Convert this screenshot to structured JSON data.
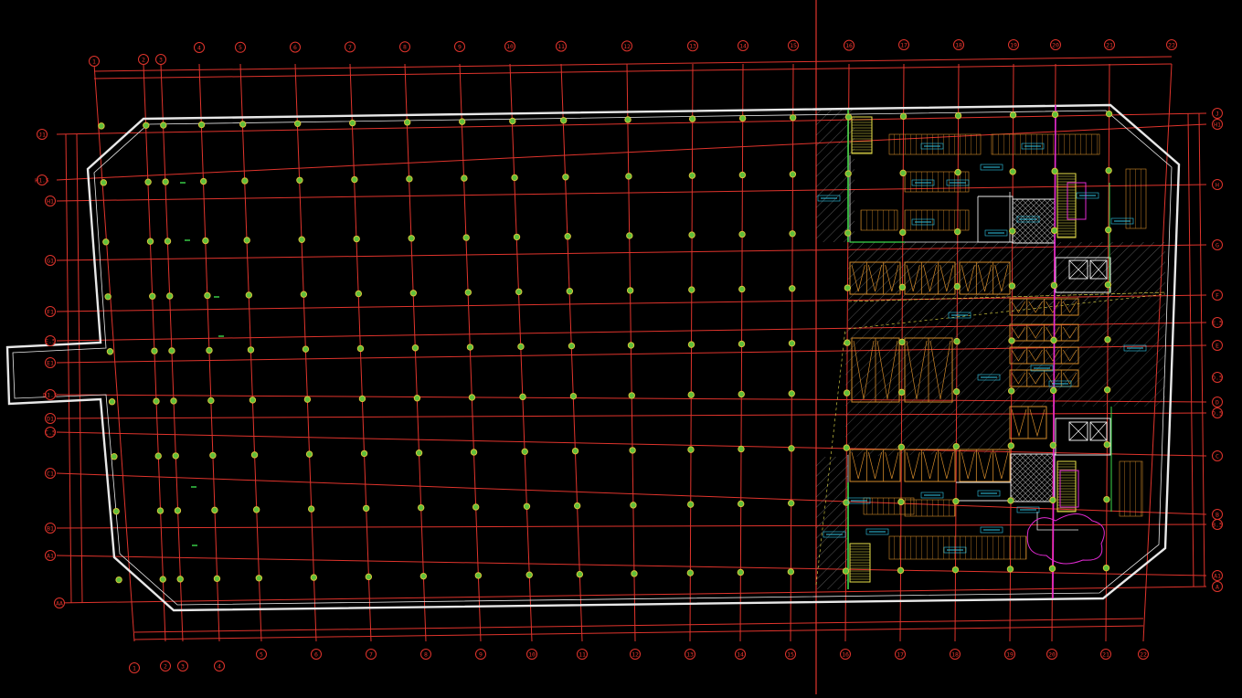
{
  "drawing": {
    "background": "#000000",
    "colors": {
      "grid": "#e0342c",
      "outline": "#e8e8e8",
      "column": "#d7c43a",
      "column_dot": "#5fbf3a",
      "text": "#31c8e8",
      "stall": "#d28a2a",
      "stair": "#e8e04a",
      "green": "#3bd84a",
      "magenta": "#e22ad2",
      "hatch": "#8a8a8a"
    },
    "top_axis_labels": [
      "1",
      "2",
      "3",
      "4",
      "5",
      "6",
      "7",
      "8",
      "9",
      "10",
      "11",
      "12",
      "13",
      "14",
      "15",
      "16",
      "17",
      "18",
      "19",
      "20",
      "21",
      "22"
    ],
    "bottom_axis_labels": [
      "1",
      "2",
      "3",
      "4",
      "5",
      "6",
      "7",
      "8",
      "9",
      "10",
      "11",
      "12",
      "13",
      "14",
      "15",
      "16",
      "17",
      "18",
      "19",
      "20",
      "21",
      "22"
    ],
    "left_axis_labels": [
      "J1",
      "H1.5",
      "H1",
      "G1",
      "F1",
      "E.5",
      "E1",
      "D1.5",
      "D1",
      "C.5",
      "C1",
      "B1",
      "A1",
      "AA"
    ],
    "right_axis_labels": [
      "J",
      "H1",
      "H",
      "G",
      "F",
      "E.5",
      "E",
      "D.5",
      "D",
      "D.5",
      "C",
      "B",
      "B.5",
      "A1",
      "A"
    ]
  }
}
